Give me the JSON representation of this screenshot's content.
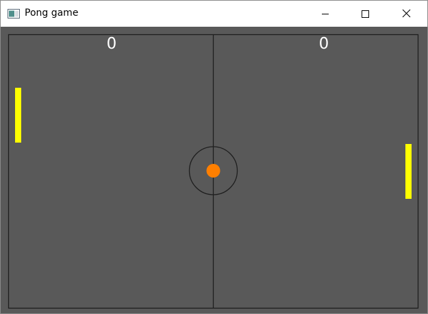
{
  "window": {
    "title": "Pong game",
    "icon": "app-window-icon",
    "controls": {
      "minimize_icon": "minimize-icon",
      "maximize_icon": "maximize-icon",
      "close_icon": "close-icon"
    }
  },
  "game": {
    "score_left": "0",
    "score_right": "0",
    "colors": {
      "background": "#595959",
      "paddle": "#ffff00",
      "ball": "#ff7f00",
      "lines": "#1e1e1e",
      "score_text": "#ffffff"
    }
  }
}
